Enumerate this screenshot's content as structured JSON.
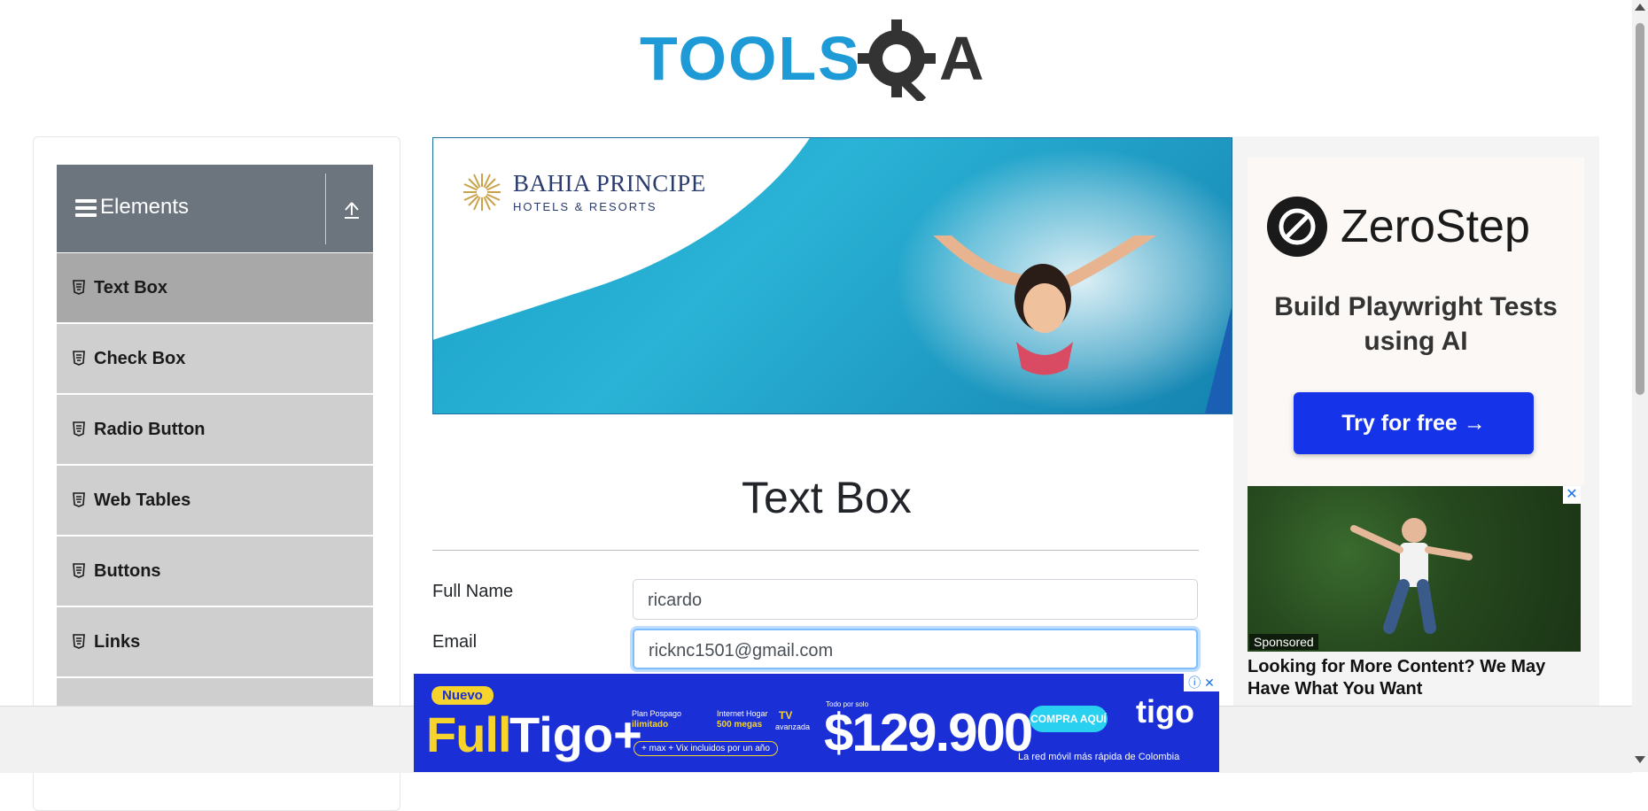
{
  "header": {
    "logo_text": "TOOLSQA"
  },
  "sidebar": {
    "group_title": "Elements",
    "items": [
      {
        "label": "Text Box",
        "active": true
      },
      {
        "label": "Check Box",
        "active": false
      },
      {
        "label": "Radio Button",
        "active": false
      },
      {
        "label": "Web Tables",
        "active": false
      },
      {
        "label": "Buttons",
        "active": false
      },
      {
        "label": "Links",
        "active": false
      }
    ]
  },
  "banner_ad": {
    "brand_name": "BAHIA PRINCIPE",
    "brand_sub": "HOTELS & RESORTS"
  },
  "main": {
    "title": "Text Box",
    "form": {
      "full_name_label": "Full Name",
      "full_name_value": "ricardo",
      "email_label": "Email",
      "email_value": "ricknc1501@gmail.com"
    }
  },
  "right_ad": {
    "brand": "ZeroStep",
    "headline": "Build Playwright Tests using AI",
    "cta": "Try for free →",
    "sponsored_badge": "Sponsored",
    "sponsored_text": "Looking for More Content? We May Have What You Want"
  },
  "bottom_ad": {
    "nuevo": "Nuevo",
    "full": "Full",
    "tigo_plus": "Tigo+",
    "plan_line1": "Plan Pospago",
    "plan_line2": "ilimitado",
    "internet_line1": "Internet Hogar",
    "internet_line2": "500 megas",
    "tv_line1": "TV",
    "tv_line2": "avanzada",
    "extras": "+ max + Vix incluidos por un año",
    "price_prefix": "Todo por solo",
    "price": "$129.900",
    "button": "COMPRA AQUÍ",
    "logo": "tigo",
    "tagline": "La red móvil más rápida de Colombia"
  },
  "colors": {
    "sidebar_header": "#6c757d",
    "menu_item": "#cfcfcf",
    "menu_item_active": "#a8a8a8",
    "logo_blue": "#1e9bd7",
    "zerostep_cta": "#1533e8",
    "tigo_blue": "#1a2fd6"
  }
}
